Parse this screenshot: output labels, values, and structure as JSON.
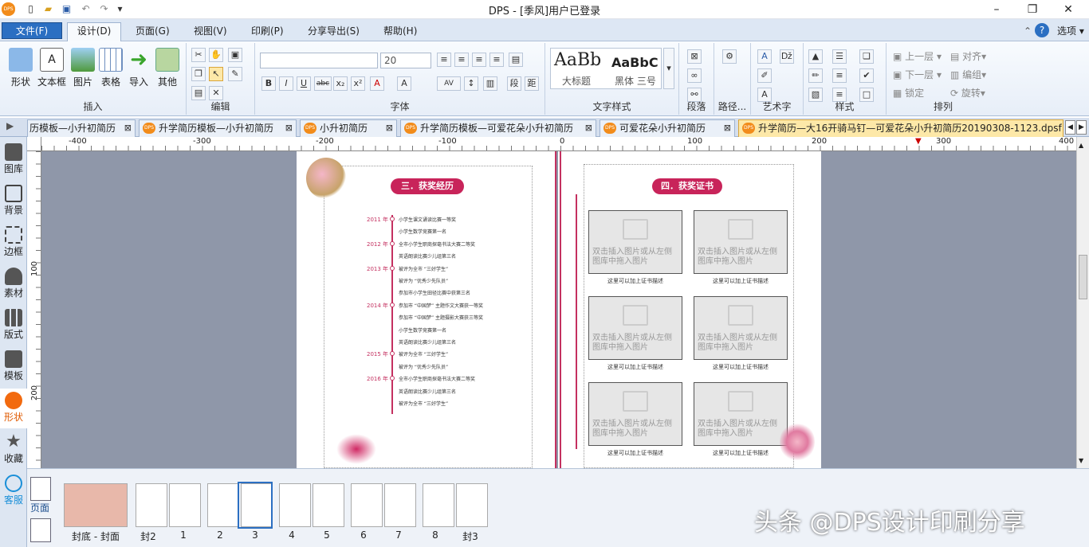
{
  "window": {
    "title": "DPS - [季风]用户已登录",
    "logo": "DPS",
    "controls": [
      "–",
      "❐",
      "✕"
    ]
  },
  "menu": {
    "file": "文件(F)",
    "tabs": [
      "设计(D)",
      "页面(G)",
      "视图(V)",
      "印刷(P)",
      "分享导出(S)",
      "帮助(H)"
    ],
    "options": "选项"
  },
  "ribbon": {
    "insert": {
      "label": "插入",
      "buttons": [
        "形状",
        "文本框",
        "图片",
        "表格",
        "导入",
        "其他"
      ]
    },
    "edit": {
      "label": "编辑"
    },
    "font": {
      "label": "字体",
      "size": "20",
      "format_buttons": [
        "B",
        "I",
        "U",
        "abc",
        "x₂",
        "x²",
        "A",
        "A"
      ]
    },
    "styles": {
      "label": "文字样式",
      "preview1": "AaBb",
      "preview1_sub": "大标题",
      "preview2": "AaBbC",
      "preview2_sub": "黑体 三号"
    },
    "para": {
      "label": "段落"
    },
    "path": {
      "label": "路径..."
    },
    "art": {
      "label": "艺术字"
    },
    "style": {
      "label": "样式"
    },
    "arrange": {
      "label": "排列",
      "items": [
        "上一层",
        "下一层",
        "锁定",
        "对齐",
        "编组",
        "旋转"
      ]
    }
  },
  "doc_tabs": [
    "历模板—小升初简历",
    "升学简历模板—小升初简历",
    "小升初简历",
    "升学简历模板—可爱花朵小升初简历",
    "可爱花朵小升初简历",
    "升学简历—大16开骑马钉—可爱花朵小升初简历20190308-1123.dpsf"
  ],
  "sidebar": [
    "图库",
    "背景",
    "边框",
    "素材",
    "版式",
    "模板",
    "形状",
    "收藏",
    "客服"
  ],
  "ruler": {
    "h": [
      "-400",
      "-300",
      "-200",
      "-100",
      "0",
      "100",
      "200",
      "300",
      "400"
    ],
    "v": [
      "100",
      "200"
    ]
  },
  "left_page": {
    "heading": "三．获奖经历",
    "timeline": [
      {
        "year": "2011 年",
        "items": [
          "小学生课文诵读比赛一等奖",
          "小学生数学竞赛第一名"
        ]
      },
      {
        "year": "2012 年",
        "items": [
          "全市小学生职商探毫书法大赛二等奖",
          "英语朗读比赛少儿组第三名"
        ]
      },
      {
        "year": "2013 年",
        "items": [
          "被评为全市 “三好学生”",
          "被评为 “优秀少先队员”",
          "参加市小学生田径比赛中获第三名"
        ]
      },
      {
        "year": "2014 年",
        "items": [
          "参加市 “中国梦” 主题作文大赛获一等奖",
          "参加市 “中国梦” 主题摄影大赛获三等奖",
          "小学生数学竞赛第一名",
          "英语朗读比赛少儿组第三名"
        ]
      },
      {
        "year": "2015 年",
        "items": [
          "被评为全市 “三好学生”",
          "被评为 “优秀少先队员”"
        ]
      },
      {
        "year": "2016 年",
        "items": [
          "全市小学生职商探毫书法大赛二等奖",
          "英语朗读比赛少儿组第三名",
          "被评为全市 “三好学生”"
        ]
      }
    ]
  },
  "right_page": {
    "heading": "四．获奖证书",
    "placeholder": "双击插入图片或从左侧图库中拖入图片",
    "caption": "这里可以加上证书描述"
  },
  "thumbnails": {
    "page_label": "页面",
    "labels": [
      "封底 - 封面",
      "封2",
      "1",
      "2",
      "3",
      "4",
      "5",
      "6",
      "7",
      "8",
      "封3"
    ]
  },
  "watermark": "头条 @DPS设计印刷分享"
}
